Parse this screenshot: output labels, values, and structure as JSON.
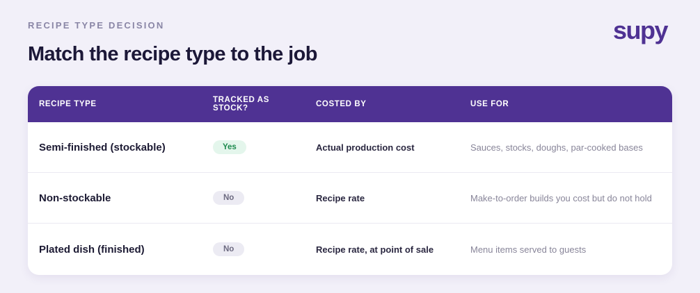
{
  "header": {
    "eyebrow": "RECIPE TYPE DECISION",
    "title": "Match the recipe type to the job",
    "logo": "supy"
  },
  "table": {
    "columns": [
      "RECIPE TYPE",
      "TRACKED AS STOCK?",
      "COSTED BY",
      "USE FOR"
    ],
    "rows": [
      {
        "type": "Semi-finished (stockable)",
        "tracked": "Yes",
        "costed_by": "Actual production cost",
        "use_for": "Sauces, stocks, doughs, par-cooked bases"
      },
      {
        "type": "Non-stockable",
        "tracked": "No",
        "costed_by": "Recipe rate",
        "use_for": "Make-to-order builds you cost but do not hold"
      },
      {
        "type": "Plated dish (finished)",
        "tracked": "No",
        "costed_by": "Recipe rate, at point of sale",
        "use_for": "Menu items served to guests"
      }
    ]
  },
  "colors": {
    "brand": "#4f3293",
    "background": "#f2f0f9",
    "yes_badge_bg": "#e4f6ec",
    "yes_badge_text": "#1d8a4e",
    "no_badge_bg": "#ecebf3",
    "no_badge_text": "#6c6a80"
  }
}
